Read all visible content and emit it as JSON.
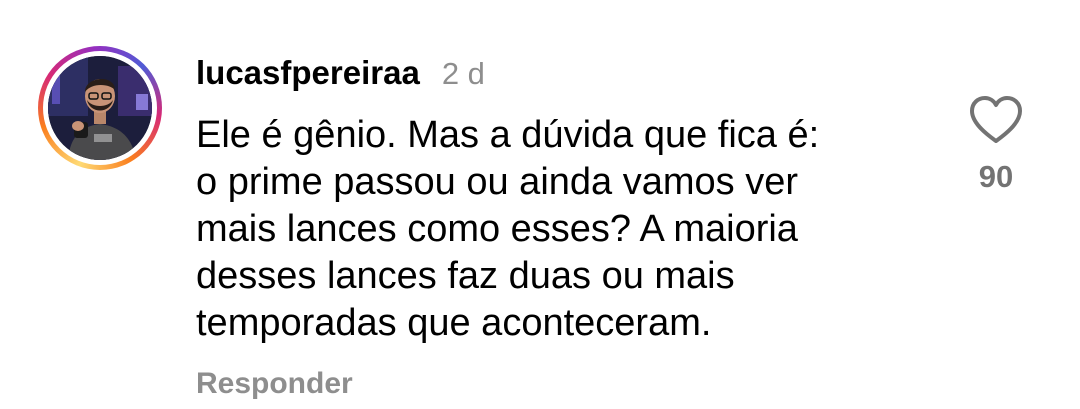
{
  "comment": {
    "username": "lucasfpereiraa",
    "timestamp": "2 d",
    "text_lines": [
      "Ele é gênio. Mas a dúvida que fica é:",
      "o prime passou ou ainda vamos ver",
      "mais lances como esses? A maioria",
      "desses lances faz duas ou mais",
      "temporadas que aconteceram."
    ],
    "reply_label": "Responder",
    "like_count": "90",
    "like_icon": "heart-outline-icon",
    "avatar_has_story_ring": true
  },
  "colors": {
    "text": "#000000",
    "secondary_text": "#8e8e8e",
    "like_count": "#737373",
    "story_ring": [
      "#feda75",
      "#fa7e1e",
      "#d62976",
      "#962fbf"
    ]
  }
}
